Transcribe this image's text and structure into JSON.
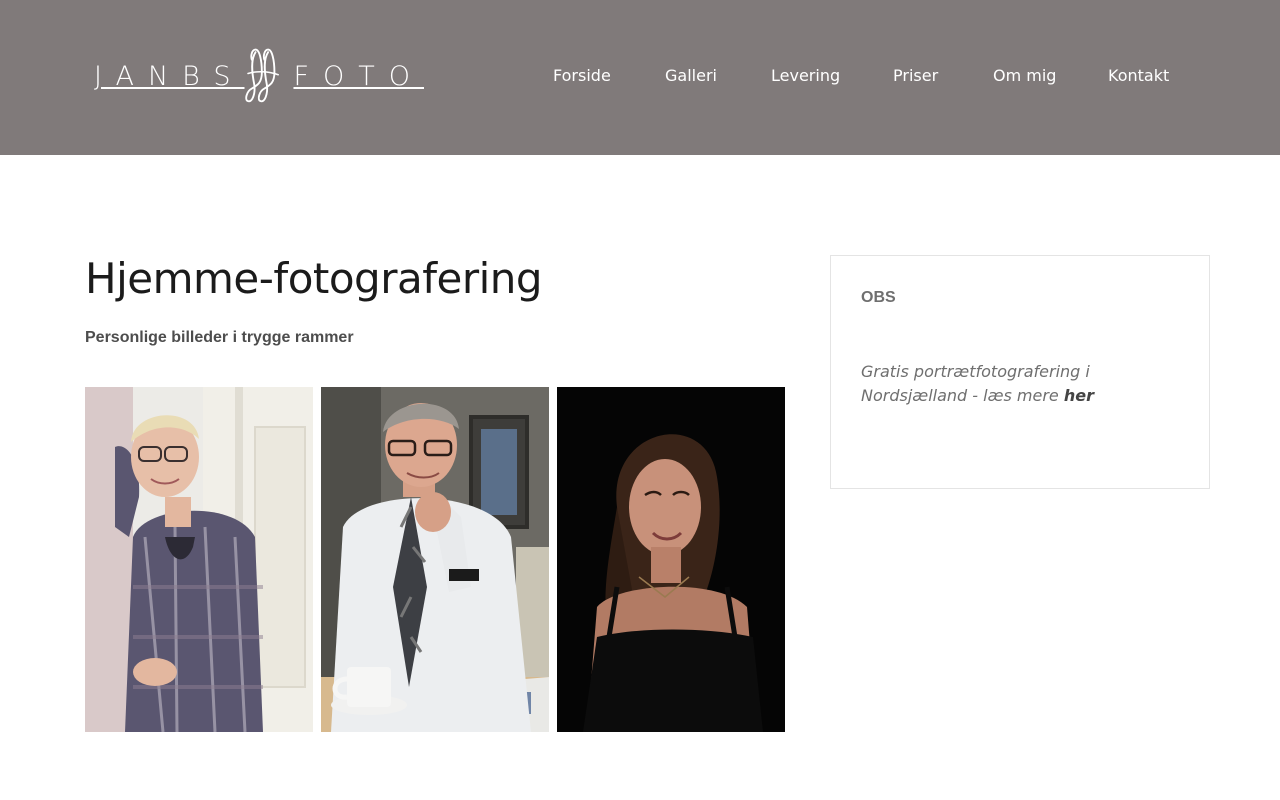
{
  "brand": {
    "left_word": "JANBS",
    "right_word": "FOTO",
    "logo_icon": "jf-monogram-icon"
  },
  "nav": {
    "items": [
      {
        "label": "Forside"
      },
      {
        "label": "Galleri"
      },
      {
        "label": "Levering"
      },
      {
        "label": "Priser"
      },
      {
        "label": "Om mig"
      },
      {
        "label": "Kontakt"
      }
    ]
  },
  "main": {
    "title": "Hjemme-fotografering",
    "subtitle": "Personlige billeder i trygge rammer",
    "photos": [
      {
        "name": "portrait-woman-checked-shirt"
      },
      {
        "name": "portrait-man-with-coffee"
      },
      {
        "name": "portrait-young-woman-dark-background"
      }
    ]
  },
  "sidebar": {
    "box_title": "OBS",
    "text_prefix": "Gratis portrætfotografering i Nordsjælland - læs mere ",
    "link_label": "her"
  },
  "colors": {
    "header_bg": "#807a7a",
    "text_dark": "#1b1b1b",
    "text_muted": "#6f6f6f"
  }
}
